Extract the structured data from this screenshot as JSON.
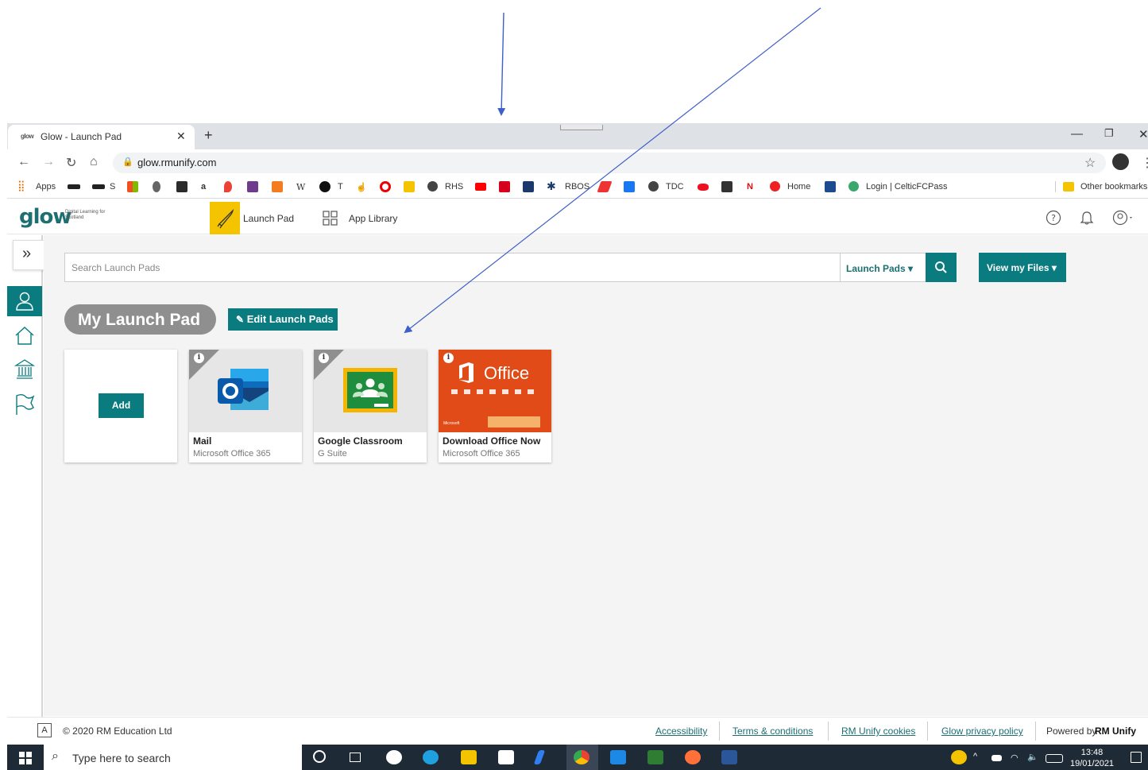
{
  "browser": {
    "tab_title": "Glow - Launch Pad",
    "tab_favicon_text": "glow",
    "url": "glow.rmunify.com",
    "bookmarks": [
      {
        "label": "Apps"
      },
      {
        "label": "S"
      },
      {
        "label": "T"
      },
      {
        "label": "RHS"
      },
      {
        "label": "RBOS"
      },
      {
        "label": "TDC"
      },
      {
        "label": "Home"
      },
      {
        "label": "Login | CelticFCPass"
      },
      {
        "label": "Other bookmarks"
      }
    ]
  },
  "header": {
    "logo_text": "glow",
    "logo_tagline": "Digital Learning for Scotland",
    "nav": [
      {
        "label": "Launch Pad"
      },
      {
        "label": "App Library"
      }
    ]
  },
  "search": {
    "placeholder": "Search Launch Pads",
    "scope": "Launch Pads ▾",
    "view_files": "View my Files ▾"
  },
  "launchpad": {
    "title": "My Launch Pad",
    "edit_label": "Edit Launch Pads",
    "add_label": "Add",
    "tiles": [
      {
        "name": "Mail",
        "provider": "Microsoft Office 365",
        "icon": "outlook-icon"
      },
      {
        "name": "Google Classroom",
        "provider": "G Suite",
        "icon": "google-classroom-icon"
      },
      {
        "name": "Download Office Now",
        "provider": "Microsoft Office 365",
        "icon": "office-icon",
        "banner_title": "Office",
        "banner_caption": "Microsoft"
      }
    ]
  },
  "footer": {
    "accessibility_badge": "A",
    "copyright": "© 2020 RM Education Ltd",
    "links": [
      "Accessibility",
      "Terms & conditions",
      "RM Unify cookies",
      "Glow privacy policy"
    ],
    "powered_by": "Powered by",
    "brand": "RM Unify"
  },
  "taskbar": {
    "search_placeholder": "Type here to search",
    "time": "13:48",
    "date": "19/01/2021"
  },
  "colors": {
    "accent": "#0a7c7f",
    "launchpad_highlight": "#f4c400",
    "office_tile": "#d83b01",
    "annotation_arrow": "#3f5fc8"
  }
}
